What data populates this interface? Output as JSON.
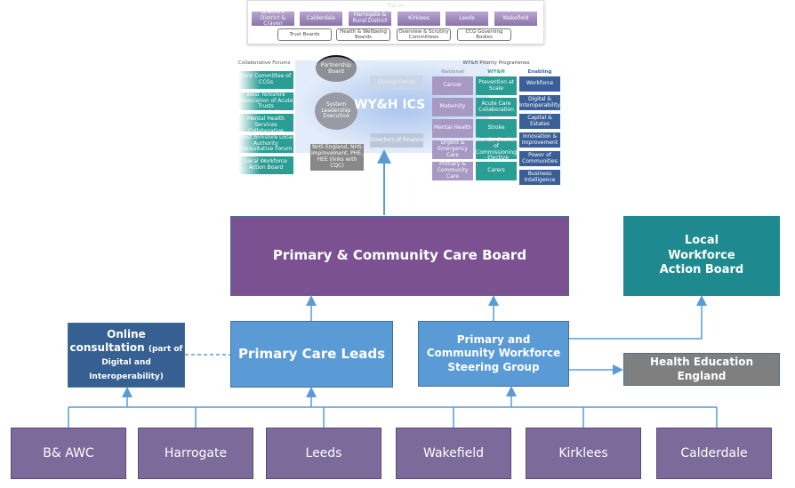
{
  "ics_image": {
    "places_heading": "Places",
    "places": [
      "Bradford District & Craven",
      "Calderdale",
      "Harrogate & Rural District",
      "Kirklees",
      "Leeds",
      "Wakefield"
    ],
    "forums": [
      "Trust Boards",
      "Health & Wellbeing Boards",
      "Overview & Scrutiny Committees",
      "CCG Governing Bodies"
    ],
    "collab_heading": "Collaborative Forums",
    "collab_forums": [
      "Joint Committee of CCGs",
      "West Yorkshire Association of Acute Trusts",
      "West Yorkshire Mental Health Services Collaborative",
      "West Yorkshire Local Authority Consultative Forum",
      "Local Workforce Action Board"
    ],
    "partnership_board": "Partnership Board",
    "system_leadership": "System Leadership Executive",
    "clinical_forum": "Clinical Forum",
    "directors_finance": "Directors of Finance",
    "nhs_england": "NHS England, NHS Improvement, PHE, HEE (links with CQC)",
    "ics_title": "WY&H ICS",
    "programmes_heading": "WY&H Priority Programmes",
    "col_national": "National",
    "col_wyh": "WY&H",
    "col_enabling": "Enabling",
    "national": [
      "Cancer",
      "Maternity",
      "Mental Health",
      "Urgent & Emergency Care",
      "Primary & Community Care"
    ],
    "wyh": [
      "Prevention at Scale",
      "Acute Care Collaboration",
      "Stroke",
      "Standardisation of Commissioning - Elective",
      "Carers"
    ],
    "enabling": [
      "Workforce",
      "Digital & Interoperability",
      "Capital & Estates",
      "Innovation & Improvement",
      "Power of Communities",
      "Business Intelligence"
    ]
  },
  "boxes": {
    "board": "Primary & Community Care Board",
    "lwab": "Local Workforce Action Board",
    "online_main": "Online consultation",
    "online_note": "(part of Digital and Interoperability)",
    "pcl": "Primary Care Leads",
    "steering": "Primary and Community Workforce Steering Group",
    "hee": "Health Education England"
  },
  "places": [
    "B& AWC",
    "Harrogate",
    "Leeds",
    "Wakefield",
    "Kirklees",
    "Calderdale"
  ],
  "colors": {
    "purple": "#7B5191",
    "teal": "#1E8A8F",
    "dark_blue": "#366092",
    "light_blue": "#5B9BD5",
    "grey": "#7F7F7F",
    "place": "#7B6A9A",
    "line": "#5B9BD5"
  }
}
